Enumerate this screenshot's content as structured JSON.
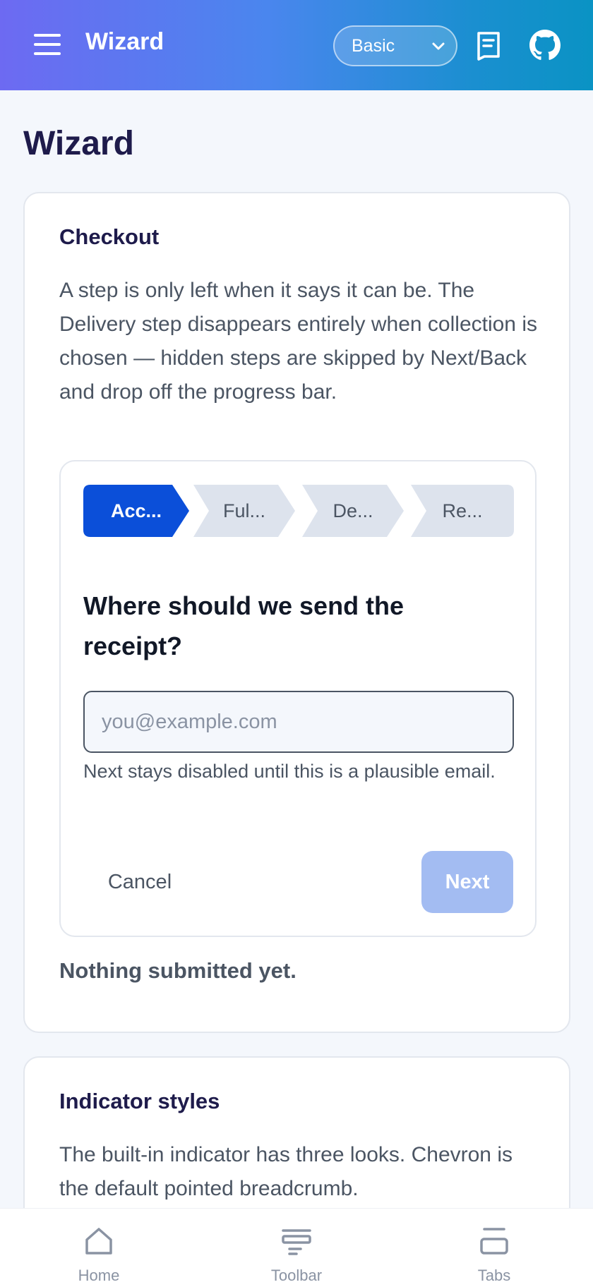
{
  "header": {
    "title": "Wizard",
    "menu_icon": "hamburger-icon",
    "select_value": "Basic",
    "select_options": [
      "Basic"
    ],
    "docs_icon": "book-icon",
    "github_icon": "github-icon",
    "gradient": [
      "#6d6af2",
      "#0a93c4"
    ]
  },
  "page": {
    "title": "Wizard"
  },
  "checkout": {
    "title": "Checkout",
    "description": "A step is only left when it says it can be. The Delivery step disappears entirely when collection is chosen — hidden steps are skipped by Next/Back and drop off the progress bar.",
    "steps": [
      {
        "label": "Acc...",
        "active": true
      },
      {
        "label": "Ful...",
        "active": false
      },
      {
        "label": "De...",
        "active": false
      },
      {
        "label": "Re...",
        "active": false
      }
    ],
    "question": "Where should we send the receipt?",
    "email_value": "",
    "email_placeholder": "you@example.com",
    "hint": "Next stays disabled until this is a plausible email.",
    "cancel_label": "Cancel",
    "next_label": "Next",
    "status": "Nothing submitted yet.",
    "colors": {
      "active_step": "#0b4fd9",
      "inactive_step": "#dde3ed",
      "next_disabled": "#a3bcf2"
    }
  },
  "indicator": {
    "title": "Indicator styles",
    "description": "The built-in indicator has three looks. Chevron is the default pointed breadcrumb."
  },
  "bottom_nav": [
    {
      "label": "Home",
      "icon": "home-icon"
    },
    {
      "label": "Toolbar",
      "icon": "toolbar-icon"
    },
    {
      "label": "Tabs",
      "icon": "tabs-icon"
    }
  ]
}
